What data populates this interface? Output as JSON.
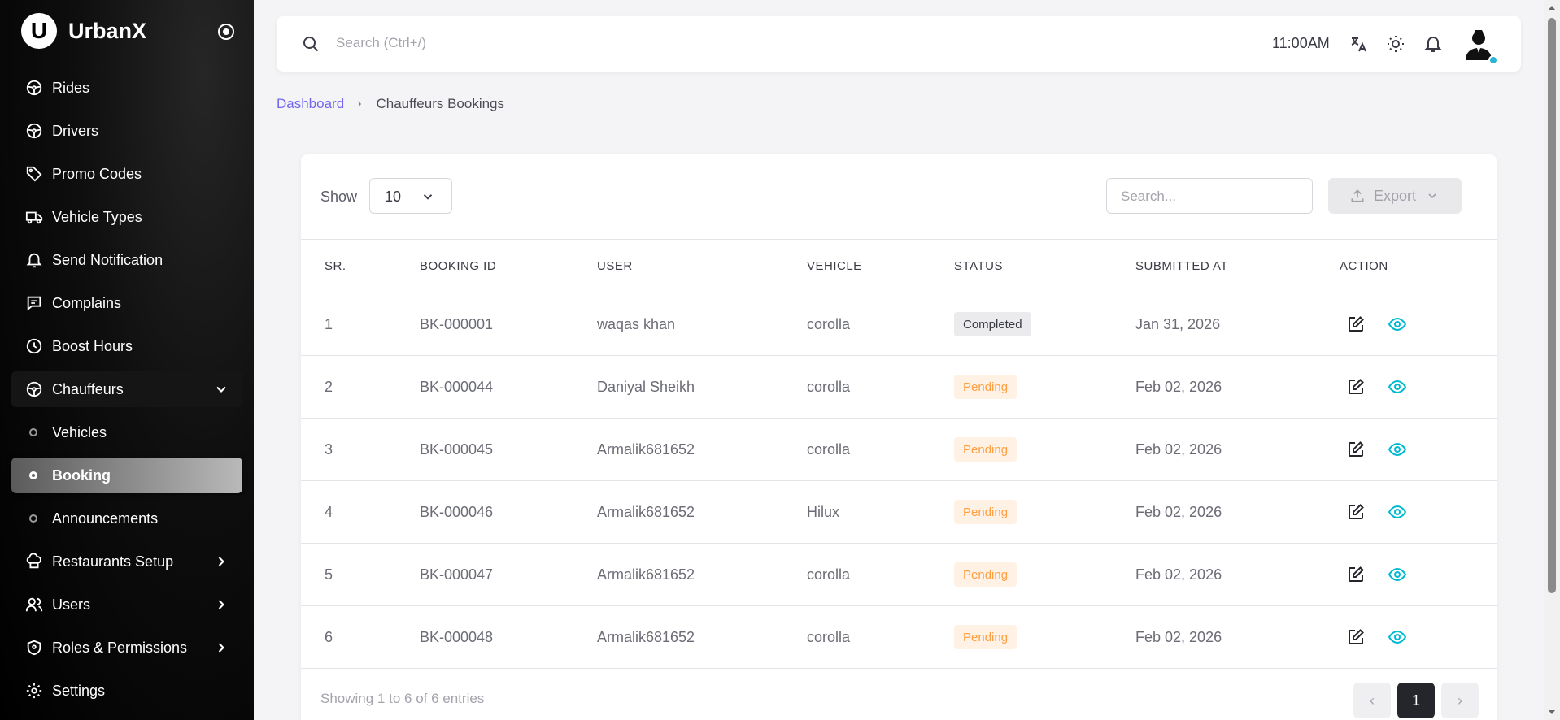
{
  "brand": {
    "logo_letter": "U",
    "name": "UrbanX"
  },
  "sidebar": {
    "items": [
      {
        "label": "Rides",
        "icon": "steering-wheel-icon"
      },
      {
        "label": "Drivers",
        "icon": "steering-wheel-icon"
      },
      {
        "label": "Promo Codes",
        "icon": "tag-icon"
      },
      {
        "label": "Vehicle Types",
        "icon": "truck-icon"
      },
      {
        "label": "Send Notification",
        "icon": "bell-icon"
      },
      {
        "label": "Complains",
        "icon": "message-icon"
      },
      {
        "label": "Boost Hours",
        "icon": "clock-icon"
      },
      {
        "label": "Chauffeurs",
        "icon": "steering-wheel-icon"
      }
    ],
    "sub_items": [
      "Vehicles",
      "Booking",
      "Announcements"
    ],
    "lower_items": [
      {
        "label": "Restaurants Setup",
        "icon": "chef-hat-icon"
      },
      {
        "label": "Users",
        "icon": "users-icon"
      },
      {
        "label": "Roles & Permissions",
        "icon": "shield-icon"
      },
      {
        "label": "Settings",
        "icon": "gear-icon"
      }
    ],
    "active_sub": "Booking"
  },
  "topbar": {
    "search_placeholder": "Search (Ctrl+/)",
    "time": "11:00AM"
  },
  "breadcrumb": {
    "parent": "Dashboard",
    "current": "Chauffeurs Bookings"
  },
  "table_controls": {
    "show_label": "Show",
    "page_size": "10",
    "search_placeholder": "Search...",
    "export_label": "Export"
  },
  "table": {
    "headers": [
      "SR.",
      "BOOKING ID",
      "USER",
      "VEHICLE",
      "STATUS",
      "SUBMITTED AT",
      "ACTION"
    ],
    "rows": [
      {
        "sr": "1",
        "booking_id": "BK-000001",
        "user": "waqas khan",
        "vehicle": "corolla",
        "status": "Completed",
        "submitted_at": "Jan 31, 2026"
      },
      {
        "sr": "2",
        "booking_id": "BK-000044",
        "user": "Daniyal Sheikh",
        "vehicle": "corolla",
        "status": "Pending",
        "submitted_at": "Feb 02, 2026"
      },
      {
        "sr": "3",
        "booking_id": "BK-000045",
        "user": "Armalik681652",
        "vehicle": "corolla",
        "status": "Pending",
        "submitted_at": "Feb 02, 2026"
      },
      {
        "sr": "4",
        "booking_id": "BK-000046",
        "user": "Armalik681652",
        "vehicle": "Hilux",
        "status": "Pending",
        "submitted_at": "Feb 02, 2026"
      },
      {
        "sr": "5",
        "booking_id": "BK-000047",
        "user": "Armalik681652",
        "vehicle": "corolla",
        "status": "Pending",
        "submitted_at": "Feb 02, 2026"
      },
      {
        "sr": "6",
        "booking_id": "BK-000048",
        "user": "Armalik681652",
        "vehicle": "corolla",
        "status": "Pending",
        "submitted_at": "Feb 02, 2026"
      }
    ]
  },
  "footer": {
    "info": "Showing 1 to 6 of 6 entries",
    "prev": "‹",
    "current_page": "1",
    "next": "›"
  },
  "colors": {
    "accent": "#7367f0",
    "pending_text": "#ff9f43",
    "pending_bg": "#fff1e3",
    "view_icon": "#00bad1",
    "active_page": "#25262b"
  }
}
